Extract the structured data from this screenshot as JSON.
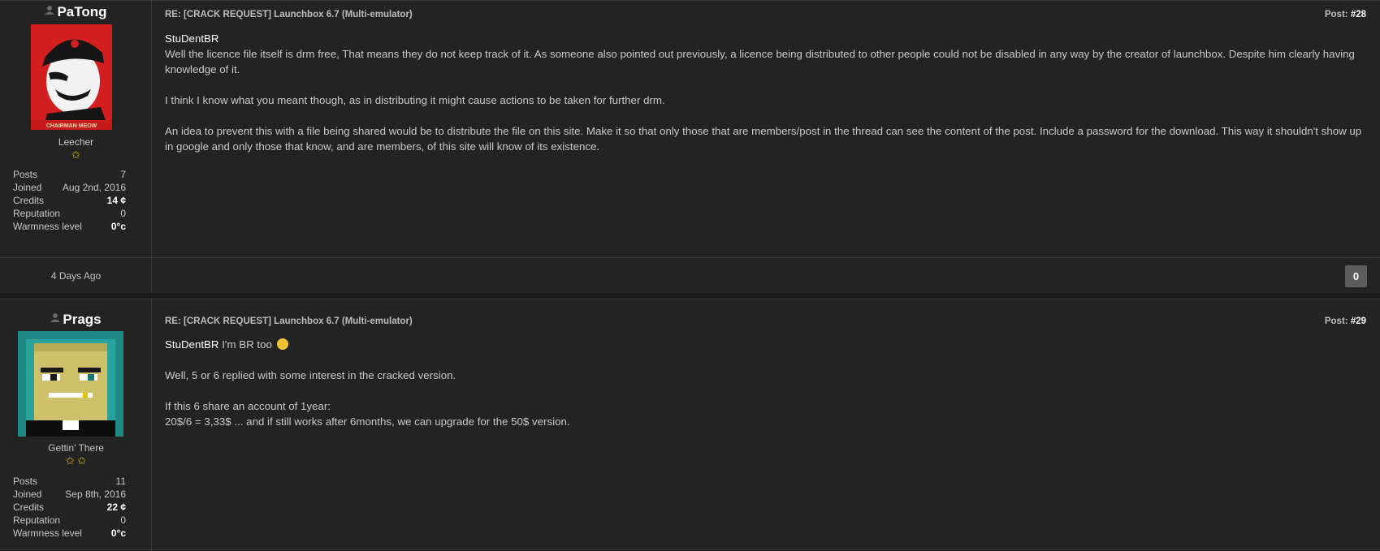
{
  "posts": [
    {
      "username": "PaTong",
      "user_title": "Leecher",
      "stars": "✩",
      "stats": [
        {
          "label": "Posts",
          "value": "7"
        },
        {
          "label": "Joined",
          "value": "Aug 2nd, 2016"
        },
        {
          "label": "Credits",
          "value": "14 ¢"
        },
        {
          "label": "Reputation",
          "value": "0"
        },
        {
          "label": "Warmness level",
          "value": "0°c"
        }
      ],
      "post_title": "RE: [CRACK REQUEST] Launchbox 6.7 (Multi-emulator)",
      "post_label": "Post:",
      "post_number": "#28",
      "quote_name": "StuDentBR",
      "paragraphs": [
        "Well the licence file itself is drm free, That means they do not keep track of it. As someone also pointed out previously, a licence being distributed to other people could not be disabled in any way by the creator of launchbox. Despite him clearly having knowledge of it.",
        "I think I know what you meant though, as in distributing it might cause actions to be taken for further drm.",
        "An idea to prevent this with a file being shared would be to distribute the file on this site. Make it so that only those that are members/post in the thread can see the content of the post. Include a password for the download. This way it shouldn't show up in google and only those that know, and are members, of this site will know of its existence."
      ],
      "date": "4 Days Ago",
      "rep_count": "0",
      "avatar_caption": "CHAIRMAN MEOW"
    },
    {
      "username": "Prags",
      "user_title": "Gettin' There",
      "stars": "✩ ✩",
      "stats": [
        {
          "label": "Posts",
          "value": "11"
        },
        {
          "label": "Joined",
          "value": "Sep 8th, 2016"
        },
        {
          "label": "Credits",
          "value": "22 ¢"
        },
        {
          "label": "Reputation",
          "value": "0"
        },
        {
          "label": "Warmness level",
          "value": "0°c"
        }
      ],
      "post_title": "RE: [CRACK REQUEST] Launchbox 6.7 (Multi-emulator)",
      "post_label": "Post:",
      "post_number": "#29",
      "quote_name": "StuDentBR",
      "quote_rest": "I'm BR too",
      "paragraphs": [
        "Well, 5 or 6 replied with some interest in the cracked version.",
        "If this 6 share an account of 1year:",
        "20$/6 = 3,33$ ... and if still works after 6months, we can upgrade for the 50$ version."
      ]
    }
  ]
}
